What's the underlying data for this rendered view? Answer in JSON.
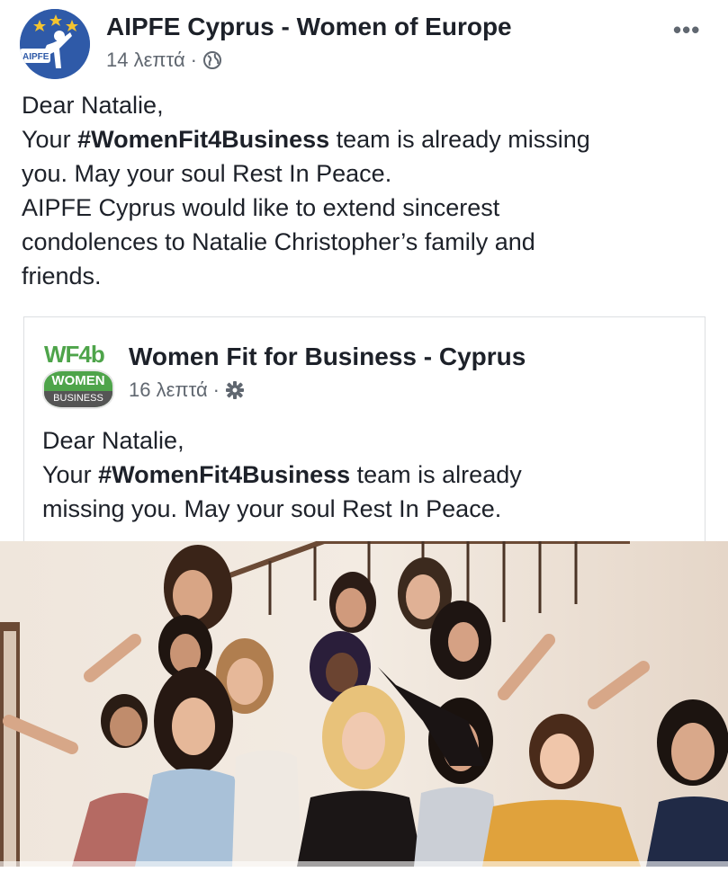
{
  "post": {
    "page_name": "AIPFE Cyprus - Women of Europe",
    "time": "14 λεπτά",
    "separator": "·",
    "avatar_label": "AIPFE",
    "more_label": "•••",
    "lines": [
      "Dear Natalie,",
      "Your ",
      "#WomenFit4Business",
      " team is already missing",
      "you. May your soul Rest In Peace.",
      "AIPFE Cyprus would like to extend sincerest",
      "condolences to Natalie Christopher’s family and",
      "friends."
    ]
  },
  "shared": {
    "page_name": "Women Fit for Business - Cyprus",
    "time": "16 λεπτά",
    "separator": "·",
    "logo_text": "WF4b",
    "logo_badge_top": "WOMEN",
    "logo_badge_bottom": "BUSINESS",
    "lines": [
      "Dear Natalie,",
      "Your ",
      "#WomenFit4Business",
      " team is already",
      "missing you. May your soul Rest In Peace."
    ]
  },
  "icons": {
    "audience": "globe-icon",
    "shared_audience": "gear-icon",
    "more": "more-icon"
  }
}
